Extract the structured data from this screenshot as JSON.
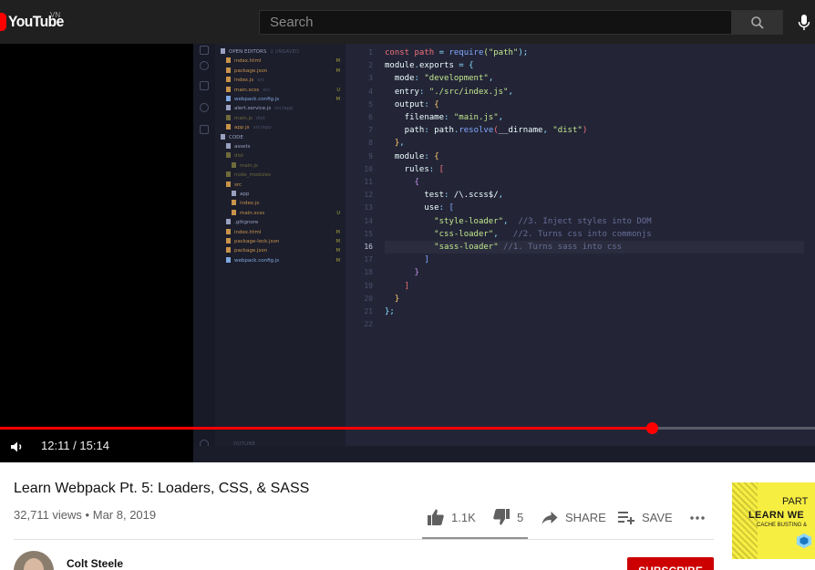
{
  "masthead": {
    "logo_text": "YouTube",
    "country_code": "VN",
    "search_placeholder": "Search",
    "search_icon": "search-icon",
    "mic_icon": "mic-icon",
    "colors": {
      "background": "#202020",
      "logo_red": "#ff0000"
    }
  },
  "player": {
    "current_time": "12:11",
    "duration": "15:14",
    "time_display": "12:11 / 15:14",
    "progress_fraction": 0.8,
    "volume_icon": "volume-icon",
    "progress_color": "#ff0000"
  },
  "editor": {
    "explorer_items": [
      {
        "label": "OPEN EDITORS",
        "hint": "1 UNSAVED",
        "indent": 0,
        "color": "#9aa0c0",
        "mark": ""
      },
      {
        "label": "index.html",
        "hint": "",
        "indent": 1,
        "color": "#c8934a",
        "mark": "M"
      },
      {
        "label": "package.json",
        "hint": "",
        "indent": 1,
        "color": "#c8934a",
        "mark": "M"
      },
      {
        "label": "index.js",
        "hint": "src",
        "indent": 1,
        "color": "#c8934a",
        "mark": ""
      },
      {
        "label": "main.scss",
        "hint": "src",
        "indent": 1,
        "color": "#c8934a",
        "mark": "U"
      },
      {
        "label": "webpack.config.js",
        "hint": "",
        "indent": 1,
        "color": "#7fa7e0",
        "mark": "M"
      },
      {
        "label": "alert.service.js",
        "hint": "src/app",
        "indent": 1,
        "color": "#9aa0c0",
        "mark": ""
      },
      {
        "label": "main.js",
        "hint": "dist",
        "indent": 1,
        "color": "#6e6a3a",
        "mark": ""
      },
      {
        "label": "app.js",
        "hint": "src/app",
        "indent": 1,
        "color": "#c8934a",
        "mark": ""
      },
      {
        "label": "CODE",
        "hint": "",
        "indent": 0,
        "color": "#9aa0c0",
        "mark": ""
      },
      {
        "label": "assets",
        "hint": "",
        "indent": 1,
        "color": "#9aa0c0",
        "mark": ""
      },
      {
        "label": "dist",
        "hint": "",
        "indent": 1,
        "color": "#6e6a3a",
        "mark": ""
      },
      {
        "label": "main.js",
        "hint": "",
        "indent": 2,
        "color": "#6e6a3a",
        "mark": ""
      },
      {
        "label": "node_modules",
        "hint": "",
        "indent": 1,
        "color": "#6e6a3a",
        "mark": ""
      },
      {
        "label": "src",
        "hint": "",
        "indent": 1,
        "color": "#c8934a",
        "mark": ""
      },
      {
        "label": "app",
        "hint": "",
        "indent": 2,
        "color": "#9aa0c0",
        "mark": ""
      },
      {
        "label": "index.js",
        "hint": "",
        "indent": 2,
        "color": "#c8934a",
        "mark": ""
      },
      {
        "label": "main.scss",
        "hint": "",
        "indent": 2,
        "color": "#c8934a",
        "mark": "U"
      },
      {
        "label": ".gitignore",
        "hint": "",
        "indent": 1,
        "color": "#9aa0c0",
        "mark": ""
      },
      {
        "label": "index.html",
        "hint": "",
        "indent": 1,
        "color": "#c8934a",
        "mark": "M"
      },
      {
        "label": "package-lock.json",
        "hint": "",
        "indent": 1,
        "color": "#c8934a",
        "mark": "M"
      },
      {
        "label": "package.json",
        "hint": "",
        "indent": 1,
        "color": "#c8934a",
        "mark": "M"
      },
      {
        "label": "webpack.config.js",
        "hint": "",
        "indent": 1,
        "color": "#7fa7e0",
        "mark": "M"
      }
    ],
    "outline_label": "OUTLINE",
    "code_lines": [
      {
        "n": "1",
        "segs": [
          [
            "const ",
            "#f07178"
          ],
          [
            "path",
            "#f07178"
          ],
          [
            " = ",
            "#89ddff"
          ],
          [
            "require",
            "#82aaff"
          ],
          [
            "(",
            "#c3e88d"
          ],
          [
            "\"path\"",
            "#c3e88d"
          ],
          [
            ");",
            "#89ddff"
          ]
        ]
      },
      {
        "n": "2",
        "segs": [
          [
            "module",
            "#eeffff"
          ],
          [
            ".",
            "#89ddff"
          ],
          [
            "exports",
            "#eeffff"
          ],
          [
            " = {",
            "#89ddff"
          ]
        ]
      },
      {
        "n": "3",
        "segs": [
          [
            "  mode",
            "#eeffff"
          ],
          [
            ": ",
            "#89ddff"
          ],
          [
            "\"development\"",
            "#c3e88d"
          ],
          [
            ",",
            "#89ddff"
          ]
        ]
      },
      {
        "n": "4",
        "segs": [
          [
            "  entry",
            "#eeffff"
          ],
          [
            ": ",
            "#89ddff"
          ],
          [
            "\"./src/index.js\"",
            "#c3e88d"
          ],
          [
            ",",
            "#89ddff"
          ]
        ]
      },
      {
        "n": "5",
        "segs": [
          [
            "  output",
            "#eeffff"
          ],
          [
            ": ",
            "#89ddff"
          ],
          [
            "{",
            "#ffcb6b"
          ]
        ]
      },
      {
        "n": "6",
        "segs": [
          [
            "    filename",
            "#eeffff"
          ],
          [
            ": ",
            "#89ddff"
          ],
          [
            "\"main.js\"",
            "#c3e88d"
          ],
          [
            ",",
            "#89ddff"
          ]
        ]
      },
      {
        "n": "7",
        "segs": [
          [
            "    path",
            "#eeffff"
          ],
          [
            ": ",
            "#89ddff"
          ],
          [
            "path",
            "#eeffff"
          ],
          [
            ".",
            "#89ddff"
          ],
          [
            "resolve",
            "#82aaff"
          ],
          [
            "(",
            "#f07178"
          ],
          [
            "__dirname",
            "#eeffff"
          ],
          [
            ", ",
            "#89ddff"
          ],
          [
            "\"dist\"",
            "#c3e88d"
          ],
          [
            ")",
            "#f07178"
          ]
        ]
      },
      {
        "n": "8",
        "segs": [
          [
            "  }",
            "#ffcb6b"
          ],
          [
            ",",
            "#89ddff"
          ]
        ]
      },
      {
        "n": "9",
        "segs": [
          [
            "  module",
            "#eeffff"
          ],
          [
            ": ",
            "#89ddff"
          ],
          [
            "{",
            "#ffcb6b"
          ]
        ]
      },
      {
        "n": "10",
        "segs": [
          [
            "    rules",
            "#eeffff"
          ],
          [
            ": ",
            "#89ddff"
          ],
          [
            "[",
            "#f07178"
          ]
        ]
      },
      {
        "n": "11",
        "segs": [
          [
            "      {",
            "#c792ea"
          ]
        ]
      },
      {
        "n": "12",
        "segs": [
          [
            "        test",
            "#eeffff"
          ],
          [
            ": ",
            "#89ddff"
          ],
          [
            "/\\.scss$/",
            "#eeffff"
          ],
          [
            ",",
            "#89ddff"
          ]
        ]
      },
      {
        "n": "13",
        "segs": [
          [
            "        use",
            "#eeffff"
          ],
          [
            ": ",
            "#89ddff"
          ],
          [
            "[",
            "#82aaff"
          ]
        ]
      },
      {
        "n": "14",
        "segs": [
          [
            "          \"style-loader\"",
            "#c3e88d"
          ],
          [
            ",  ",
            "#89ddff"
          ],
          [
            "//3. Inject styles into DOM",
            "#676e95"
          ]
        ]
      },
      {
        "n": "15",
        "segs": [
          [
            "          \"css-loader\"",
            "#c3e88d"
          ],
          [
            ",   ",
            "#89ddff"
          ],
          [
            "//2. Turns css into commonjs",
            "#676e95"
          ]
        ]
      },
      {
        "n": "16",
        "segs": [
          [
            "          \"sass-loader\"",
            "#c3e88d"
          ],
          [
            " ",
            "#89ddff"
          ],
          [
            "//1. Turns sass into css",
            "#676e95"
          ]
        ]
      },
      {
        "n": "17",
        "segs": [
          [
            "        ]",
            "#82aaff"
          ]
        ]
      },
      {
        "n": "18",
        "segs": [
          [
            "      }",
            "#c792ea"
          ]
        ]
      },
      {
        "n": "19",
        "segs": [
          [
            "    ]",
            "#f07178"
          ]
        ]
      },
      {
        "n": "20",
        "segs": [
          [
            "  }",
            "#ffcb6b"
          ]
        ]
      },
      {
        "n": "21",
        "segs": [
          [
            "};",
            "#89ddff"
          ]
        ]
      },
      {
        "n": "22",
        "segs": []
      }
    ]
  },
  "video": {
    "title": "Learn Webpack Pt. 5: Loaders, CSS, & SASS",
    "views": "32,711 views",
    "separator": "•",
    "date": "Mar 8, 2019"
  },
  "actions": {
    "like_count": "1.1K",
    "dislike_count": "5",
    "share_label": "SHARE",
    "save_label": "SAVE"
  },
  "channel": {
    "name": "Colt Steele",
    "subscribe_label": "SUBSCRIBE",
    "subscribe_color": "#cc0000"
  },
  "thumbnail": {
    "part_label": "PART",
    "learn_label": "LEARN WE",
    "cache_label": "CACHE BUSTING &",
    "background": "#f7ee42"
  }
}
